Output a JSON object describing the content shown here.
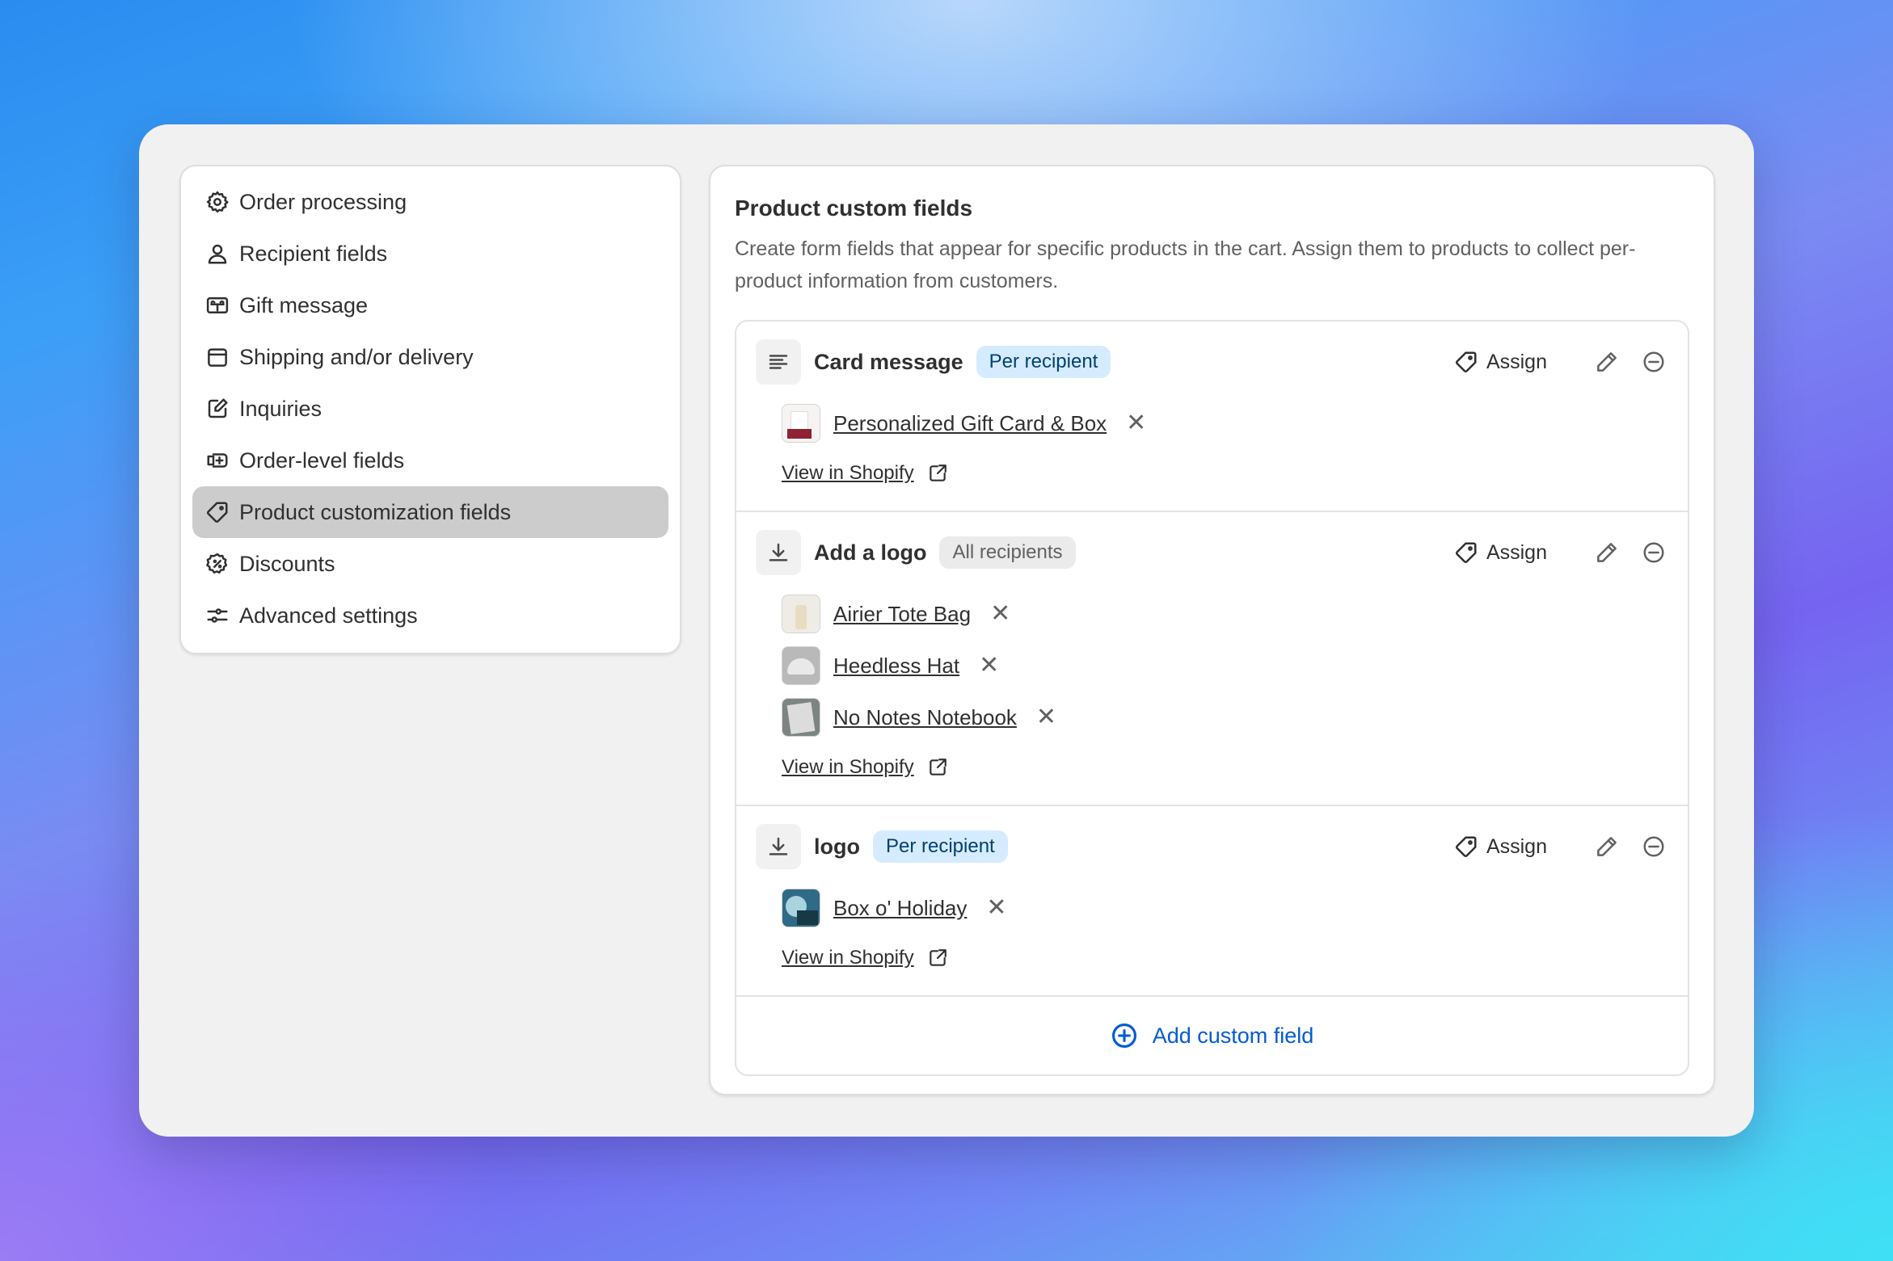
{
  "sidebar": {
    "items": [
      {
        "label": "Order processing",
        "icon": "gear-icon"
      },
      {
        "label": "Recipient fields",
        "icon": "person-icon"
      },
      {
        "label": "Gift message",
        "icon": "gift-card-icon"
      },
      {
        "label": "Shipping and/or delivery",
        "icon": "calendar-icon"
      },
      {
        "label": "Inquiries",
        "icon": "edit-icon"
      },
      {
        "label": "Order-level fields",
        "icon": "cash-register-icon"
      },
      {
        "label": "Product customization fields",
        "icon": "tag-icon",
        "active": true
      },
      {
        "label": "Discounts",
        "icon": "discount-icon"
      },
      {
        "label": "Advanced settings",
        "icon": "sliders-icon"
      }
    ]
  },
  "main": {
    "title": "Product custom fields",
    "description": "Create form fields that appear for specific products in the cart. Assign them to products to collect per-product information from customers.",
    "assign_label": "Assign",
    "view_label": "View in Shopify",
    "add_label": "Add custom field",
    "fields": [
      {
        "name": "Card message",
        "type_icon": "text-lines-icon",
        "badge": "Per recipient",
        "badge_style": "blue",
        "products": [
          "Personalized Gift Card & Box"
        ]
      },
      {
        "name": "Add a logo",
        "type_icon": "download-icon",
        "badge": "All recipients",
        "badge_style": "gray",
        "products": [
          "Airier Tote Bag",
          "Heedless Hat",
          "No Notes Notebook"
        ]
      },
      {
        "name": "logo",
        "type_icon": "download-icon",
        "badge": "Per recipient",
        "badge_style": "blue",
        "products": [
          "Box o' Holiday"
        ]
      }
    ]
  },
  "colors": {
    "accent": "#005bd3",
    "badge_blue_bg": "#d5ebff",
    "badge_gray_bg": "#ebebeb",
    "active_nav_bg": "#cccccc"
  }
}
